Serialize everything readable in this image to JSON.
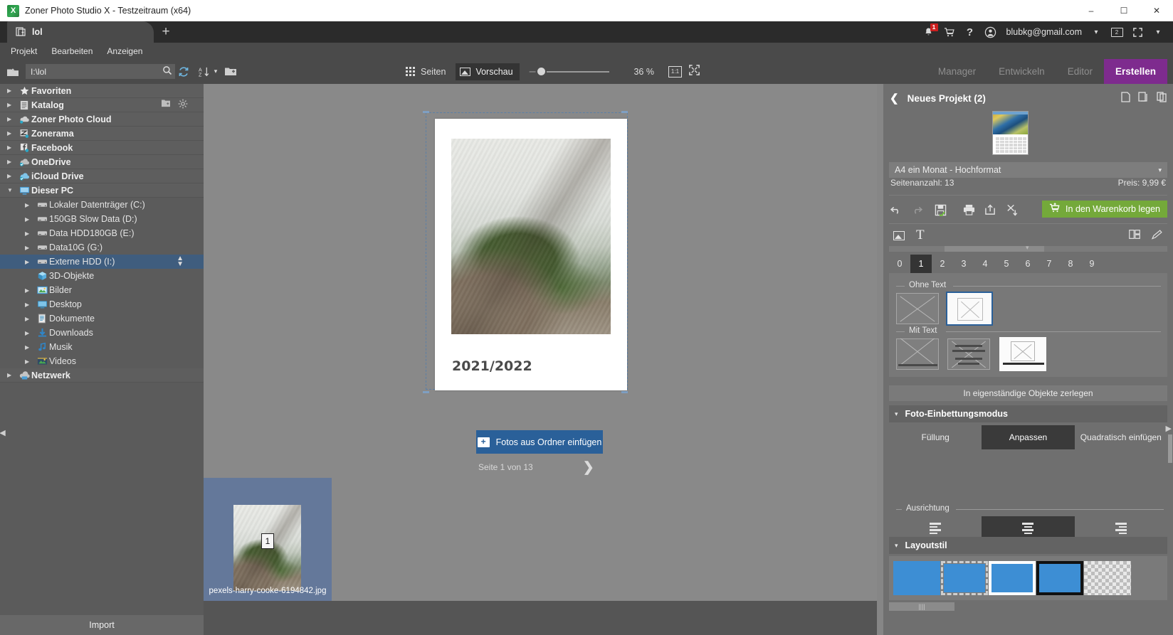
{
  "window": {
    "title": "Zoner Photo Studio X - Testzeitraum (x64)",
    "app_icon": "zoner-x-icon",
    "minimize": "–",
    "maximize": "☐",
    "close": "✕"
  },
  "tabs": {
    "items": [
      {
        "label": "lol",
        "icon": "project-tab-icon"
      }
    ],
    "add_label": "+"
  },
  "account": {
    "bell_icon": "notification-bell-icon",
    "bell_badge": "1",
    "cart_icon": "shopping-cart-icon",
    "help_icon": "question-mark-icon",
    "user_icon": "user-avatar-icon",
    "email": "blubkg@gmail.com",
    "chevron": "▾",
    "monitor_badge": "2",
    "fullscreen_icon": "expand-icon",
    "fullscreen_chevron": "▾"
  },
  "menu": {
    "items": [
      "Projekt",
      "Bearbeiten",
      "Anzeigen"
    ]
  },
  "toolbar": {
    "up_icon": "folder-up-icon",
    "path_value": "I:\\lol",
    "search_icon": "search-icon",
    "refresh_icon": "refresh-icon",
    "sort_icon": "sort-az-icon",
    "sort_chevron": "▾",
    "newfolder_icon": "new-folder-icon",
    "grid_icon": "grid-icon",
    "pages_label": "Seiten",
    "preview_icon": "preview-image-icon",
    "preview_label": "Vorschau",
    "zoom_value": "36 %",
    "one_to_one_label": "1:1",
    "fit_icon": "fit-to-screen-icon"
  },
  "modes": {
    "items": [
      {
        "label": "Manager",
        "active": false
      },
      {
        "label": "Entwickeln",
        "active": false
      },
      {
        "label": "Editor",
        "active": false
      },
      {
        "label": "Erstellen",
        "active": true
      }
    ],
    "active_color": "#7e2b8e"
  },
  "sidebar": {
    "items": [
      {
        "label": "Favoriten",
        "icon": "star-icon",
        "level": 0,
        "expanded": false,
        "selected": false
      },
      {
        "label": "Katalog",
        "icon": "catalog-icon",
        "level": 0,
        "expanded": false,
        "selected": false,
        "extra_icons": [
          "add-folder-icon",
          "gear-icon"
        ]
      },
      {
        "label": "Zoner Photo Cloud",
        "icon": "cloud-icon",
        "level": 0,
        "expanded": false,
        "selected": false
      },
      {
        "label": "Zonerama",
        "icon": "zonerama-icon",
        "level": 0,
        "expanded": false,
        "selected": false
      },
      {
        "label": "Facebook",
        "icon": "facebook-icon",
        "level": 0,
        "expanded": false,
        "selected": false
      },
      {
        "label": "OneDrive",
        "icon": "onedrive-icon",
        "level": 0,
        "expanded": false,
        "selected": false
      },
      {
        "label": "iCloud Drive",
        "icon": "icloud-icon",
        "level": 0,
        "expanded": false,
        "selected": false
      },
      {
        "label": "Dieser PC",
        "icon": "this-pc-icon",
        "level": 0,
        "expanded": true,
        "selected": false
      },
      {
        "label": "Lokaler Datenträger (C:)",
        "icon": "drive-icon",
        "level": 1,
        "expanded": false,
        "selected": false
      },
      {
        "label": "150GB Slow Data (D:)",
        "icon": "drive-icon",
        "level": 1,
        "expanded": false,
        "selected": false
      },
      {
        "label": "Data HDD180GB (E:)",
        "icon": "drive-icon",
        "level": 1,
        "expanded": false,
        "selected": false
      },
      {
        "label": "Data10G (G:)",
        "icon": "drive-icon",
        "level": 1,
        "expanded": false,
        "selected": false
      },
      {
        "label": "Externe HDD (I:)",
        "icon": "drive-icon",
        "level": 1,
        "expanded": false,
        "selected": true
      },
      {
        "label": "3D-Objekte",
        "icon": "3d-objects-icon",
        "level": 1,
        "expanded": false,
        "selected": false,
        "no_arrow": true
      },
      {
        "label": "Bilder",
        "icon": "pictures-icon",
        "level": 1,
        "expanded": false,
        "selected": false
      },
      {
        "label": "Desktop",
        "icon": "desktop-icon",
        "level": 1,
        "expanded": false,
        "selected": false
      },
      {
        "label": "Dokumente",
        "icon": "documents-icon",
        "level": 1,
        "expanded": false,
        "selected": false
      },
      {
        "label": "Downloads",
        "icon": "downloads-icon",
        "level": 1,
        "expanded": false,
        "selected": false
      },
      {
        "label": "Musik",
        "icon": "music-icon",
        "level": 1,
        "expanded": false,
        "selected": false
      },
      {
        "label": "Videos",
        "icon": "videos-icon",
        "level": 1,
        "expanded": false,
        "selected": false
      },
      {
        "label": "Netzwerk",
        "icon": "network-icon",
        "level": 0,
        "expanded": false,
        "selected": false
      }
    ],
    "import_label": "Import",
    "collapse_icon": "collapse-left-icon"
  },
  "canvas": {
    "page_year_text": "2021/2022",
    "insert_button_label": "Fotos aus Ordner einfügen",
    "insert_button_icon": "add-folder-icon",
    "page_indicator": "Seite 1 von 13",
    "next_page_icon": "chevron-right-icon",
    "collapse_icon": "chevron-down-icon"
  },
  "filmstrip": {
    "items": [
      {
        "filename": "pexels-harry-cooke-6194842.jpg",
        "number": "1",
        "selected": true
      }
    ]
  },
  "right_panel": {
    "back_icon": "chevron-left-icon",
    "title": "Neues Projekt (2)",
    "header_icons": [
      "new-page-icon",
      "duplicate-page-icon",
      "copy-page-icon"
    ],
    "project_thumb": "calendar-preview-thumb",
    "product_select": "A4 ein Monat - Hochformat",
    "select_chevron": "▾",
    "page_count_label": "Seitenanzahl: 13",
    "price_label": "Preis: 9,99 €",
    "action_icons": [
      "undo-icon",
      "redo-icon",
      "save-icon",
      "print-icon",
      "share-icon",
      "export-pdf-icon"
    ],
    "cart_button_label": "In den Warenkorb legen",
    "cart_button_icon": "cart-add-icon",
    "cart_button_color": "#74a93a",
    "content_tabs": [
      {
        "icon": "image-tab-icon",
        "label": ""
      },
      {
        "icon": "text-tab-icon",
        "label": "T"
      }
    ],
    "content_tab_right_icons": [
      "layouts-icon",
      "edit-pen-icon"
    ],
    "page_numbers": [
      "0",
      "1",
      "2",
      "3",
      "4",
      "5",
      "6",
      "7",
      "8",
      "9"
    ],
    "selected_page_number": "1",
    "templates": {
      "group_no_text_label": "Ohne Text",
      "group_with_text_label": "Mit Text",
      "no_text": [
        {
          "name": "wide-frame-template",
          "selected": false
        },
        {
          "name": "square-frame-template",
          "selected": true
        }
      ],
      "with_text": [
        {
          "name": "image-with-caption-template",
          "selected": false
        },
        {
          "name": "text-block-template",
          "selected": false
        },
        {
          "name": "square-image-with-caption-template",
          "selected": false
        }
      ]
    },
    "decompose_button_label": "In eigenständige Objekte zerlegen",
    "embed_section": {
      "title": "Foto-Einbettungsmodus",
      "caret": "▾",
      "options": [
        {
          "label": "Füllung",
          "selected": false
        },
        {
          "label": "Anpassen",
          "selected": true
        },
        {
          "label": "Quadratisch einfügen",
          "selected": false
        }
      ],
      "alignment_label": "Ausrichtung",
      "alignment_options": [
        {
          "name": "align-left-icon",
          "selected": false
        },
        {
          "name": "align-center-icon",
          "selected": true
        },
        {
          "name": "align-right-icon",
          "selected": false
        }
      ]
    },
    "layout_section": {
      "title": "Layoutstil",
      "caret": "▾",
      "swatches": [
        {
          "name": "layout-plain",
          "selected": false
        },
        {
          "name": "layout-dashed-border",
          "selected": false
        },
        {
          "name": "layout-white-border",
          "selected": false
        },
        {
          "name": "layout-black-border",
          "selected": false
        },
        {
          "name": "layout-transparent",
          "selected": false
        }
      ]
    },
    "scroll_handle_icon": "resize-handle-icon",
    "edge_collapse_icon": "collapse-right-icon"
  }
}
